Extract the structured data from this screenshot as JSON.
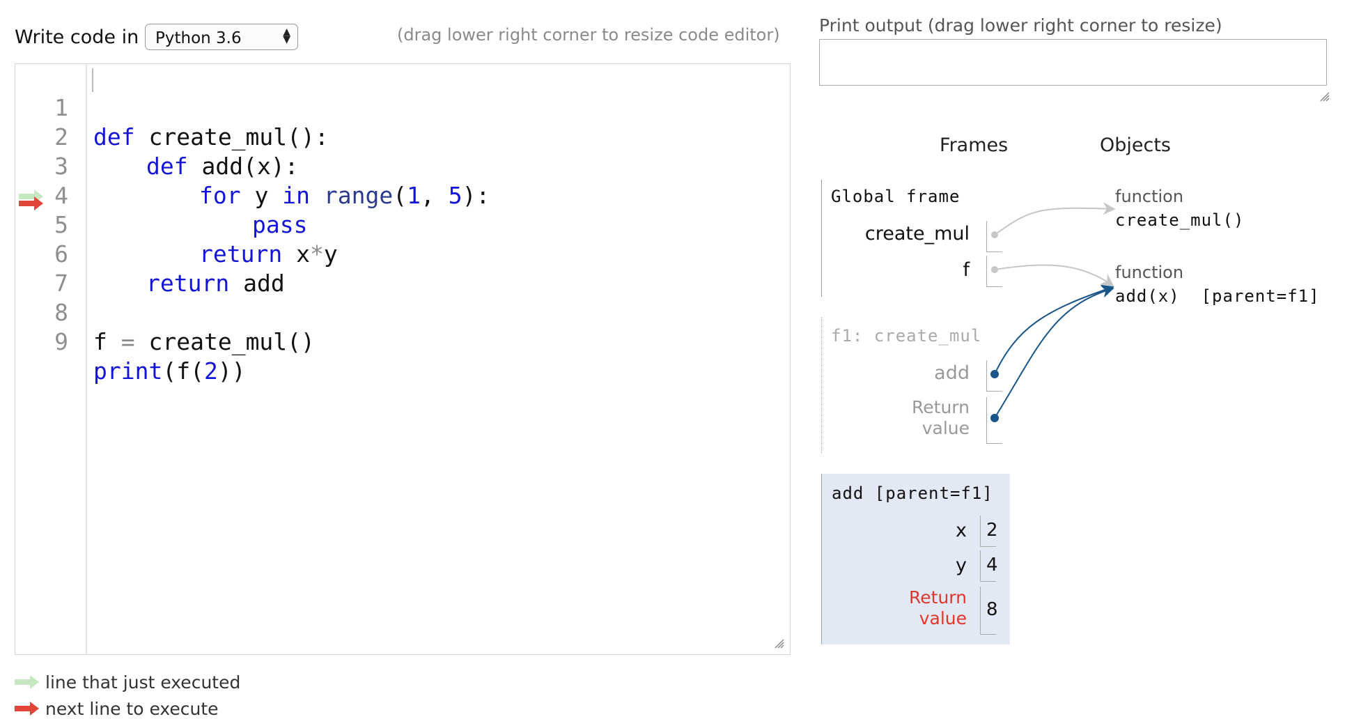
{
  "editor": {
    "write_label": "Write code in",
    "language": "Python 3.6",
    "drag_hint": "(drag lower right corner to resize code editor)",
    "lines": [
      {
        "n": "1"
      },
      {
        "n": "2"
      },
      {
        "n": "3"
      },
      {
        "n": "4"
      },
      {
        "n": "5"
      },
      {
        "n": "6"
      },
      {
        "n": "7"
      },
      {
        "n": "8"
      },
      {
        "n": "9"
      }
    ],
    "code": {
      "l1_kw": "def",
      "l1_rest": " create_mul():",
      "l2_kw": "def",
      "l2_rest": " add(x):",
      "l3_kw1": "for",
      "l3_mid": " y ",
      "l3_kw2": "in",
      "l3_sp": " ",
      "l3_bi": "range",
      "l3_p1": "(",
      "l3_n1": "1",
      "l3_c": ", ",
      "l3_n2": "5",
      "l3_p2": "):",
      "l4_kw": "pass",
      "l5_kw": "return",
      "l5_rest": " x",
      "l5_op": "*",
      "l5_y": "y",
      "l6_kw": "return",
      "l6_rest": " add",
      "l8_a": "f ",
      "l8_op": "=",
      "l8_b": " create_mul()",
      "l9_bi": "print",
      "l9_a": "(f(",
      "l9_n": "2",
      "l9_b": "))"
    },
    "current_line": 5
  },
  "legend": {
    "just_executed": "line that just executed",
    "next_line": "next line to execute"
  },
  "print_output": {
    "label": "Print output (drag lower right corner to resize)",
    "text": ""
  },
  "viz": {
    "frames_header": "Frames",
    "objects_header": "Objects",
    "global_frame": {
      "title": "Global frame",
      "vars": [
        "create_mul",
        "f"
      ]
    },
    "f1_frame": {
      "title": "f1: create_mul",
      "var_add": "add",
      "return_line1": "Return",
      "return_line2": "value"
    },
    "add_frame": {
      "title": "add [parent=f1]",
      "x_name": "x",
      "x_val": "2",
      "y_name": "y",
      "y_val": "4",
      "return_line1": "Return",
      "return_line2": "value",
      "return_val": "8"
    },
    "objects": [
      {
        "type": "function",
        "name": "create_mul()"
      },
      {
        "type": "function",
        "name": "add(x)  [parent=f1]"
      }
    ],
    "colors": {
      "pointer_active": "#1a5589",
      "pointer_inactive": "#c6c6c6",
      "return_red": "#e0362b",
      "arrow_green": "#c7e6c2",
      "arrow_red": "#e0463a"
    }
  }
}
